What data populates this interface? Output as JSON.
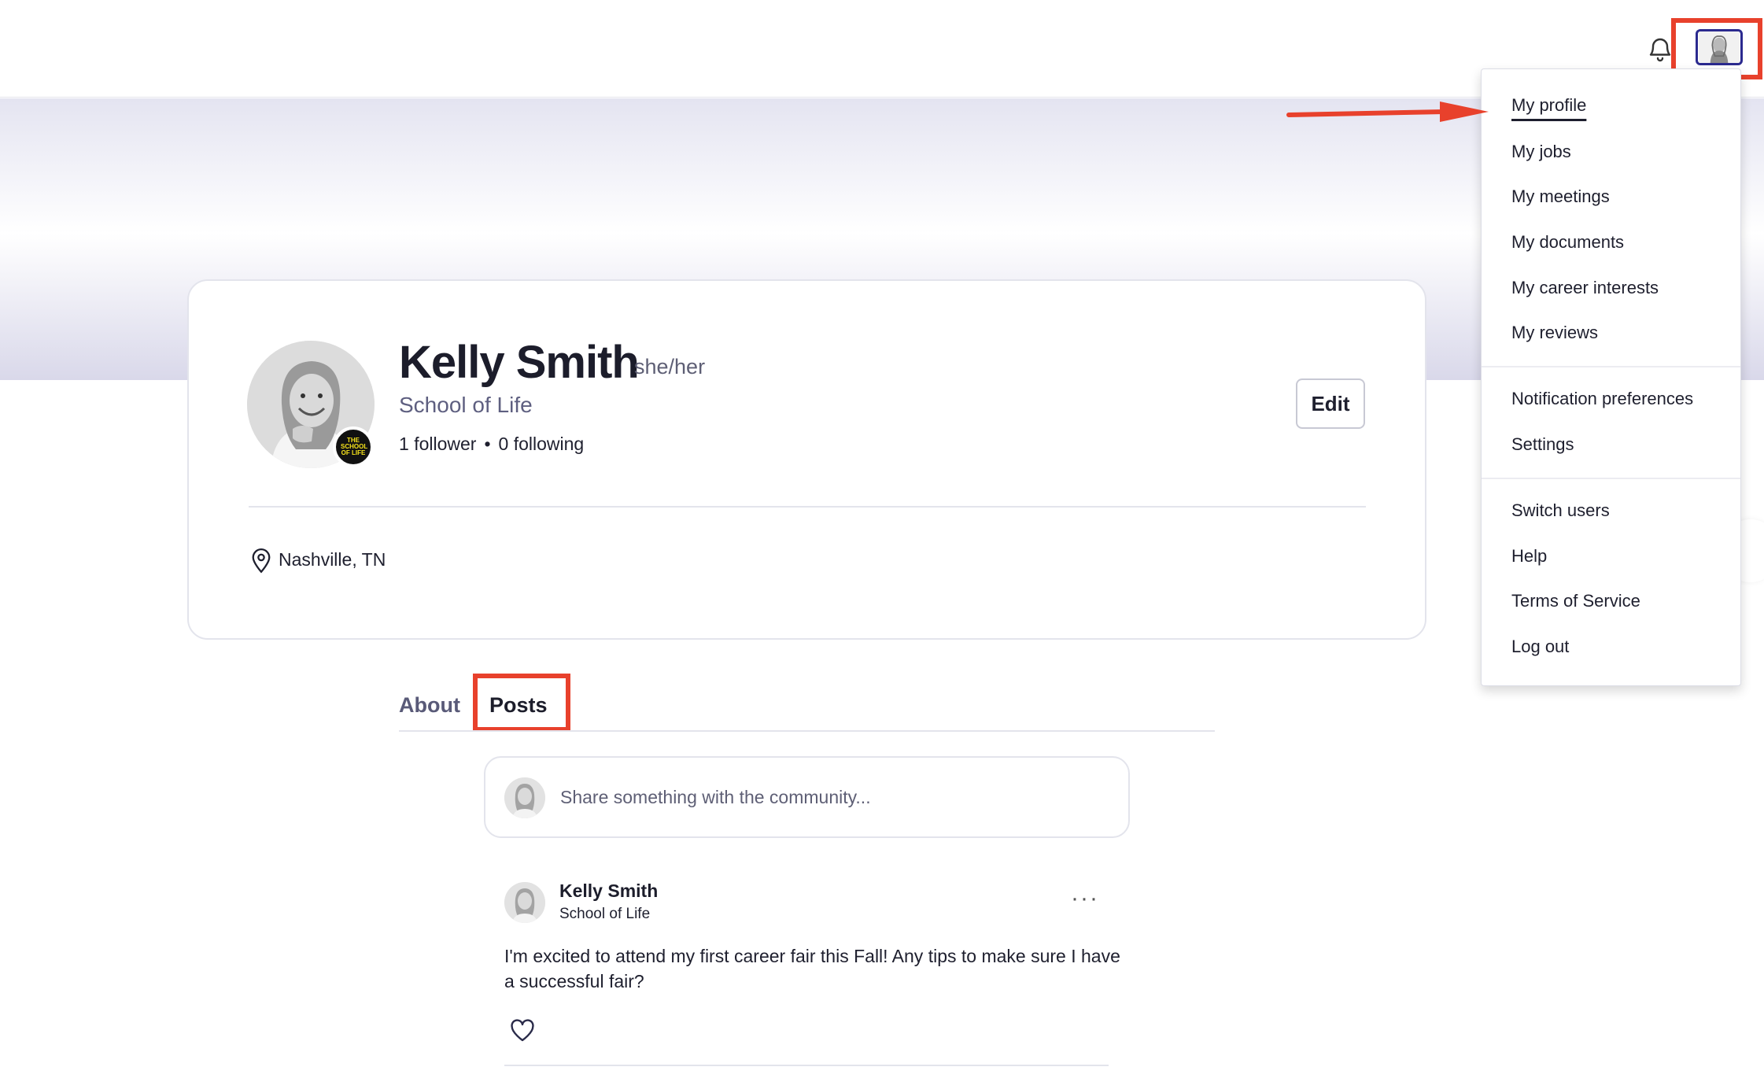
{
  "header": {
    "notification_icon": "bell-icon",
    "avatar_icon": "user-avatar-icon"
  },
  "profile": {
    "name": "Kelly Smith",
    "pronouns": "she/her",
    "school": "School of Life",
    "followers_count": "1",
    "followers_label": "follower",
    "separator": "•",
    "following_count": "0",
    "following_label": "following",
    "edit_label": "Edit",
    "location": "Nashville, TN",
    "school_badge_text": "THE SCHOOL OF LIFE"
  },
  "tabs": [
    {
      "label": "About"
    },
    {
      "label": "Posts"
    }
  ],
  "composer": {
    "placeholder": "Share something with the community..."
  },
  "post": {
    "author": "Kelly Smith",
    "school": "School of Life",
    "menu": "···",
    "body": "I'm excited to attend my first career fair this Fall! Any tips to make sure I have a successful fair?"
  },
  "dropdown": {
    "items": [
      {
        "label": "My profile"
      },
      {
        "label": "My jobs"
      },
      {
        "label": "My meetings"
      },
      {
        "label": "My documents"
      },
      {
        "label": "My career interests"
      },
      {
        "label": "My reviews"
      },
      {
        "label": "Notification preferences"
      },
      {
        "label": "Settings"
      },
      {
        "label": "Switch users"
      },
      {
        "label": "Help"
      },
      {
        "label": "Terms of Service"
      },
      {
        "label": "Log out"
      }
    ]
  },
  "colors": {
    "highlight": "#e8412c",
    "avatar_border": "#2b2a8f",
    "text_primary": "#1c1d2b",
    "text_secondary": "#5e5f80"
  }
}
